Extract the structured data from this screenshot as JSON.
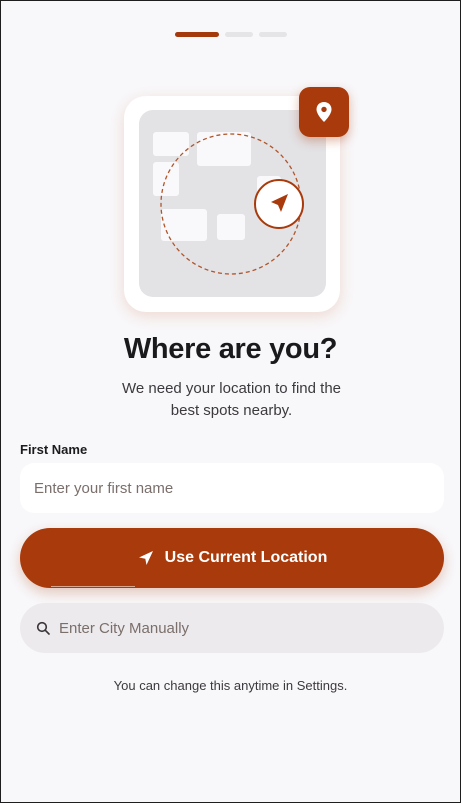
{
  "onboarding": {
    "progress": {
      "total_steps": 3,
      "current_step": 1
    },
    "illustration": {
      "main_icon": "location-arrow-icon",
      "badge_icon": "map-pin-icon",
      "accent_color": "#a93a0b"
    },
    "title": "Where are you?",
    "subtitle": "We need your location to find the best spots nearby.",
    "first_name": {
      "label": "First Name",
      "placeholder": "Enter your first name",
      "value": ""
    },
    "use_location_button": {
      "label": "Use Current Location",
      "icon": "location-arrow-icon"
    },
    "city_search": {
      "placeholder": "Enter City Manually",
      "icon": "search-icon",
      "value": ""
    },
    "footer_note": "You can change this anytime in Settings."
  }
}
